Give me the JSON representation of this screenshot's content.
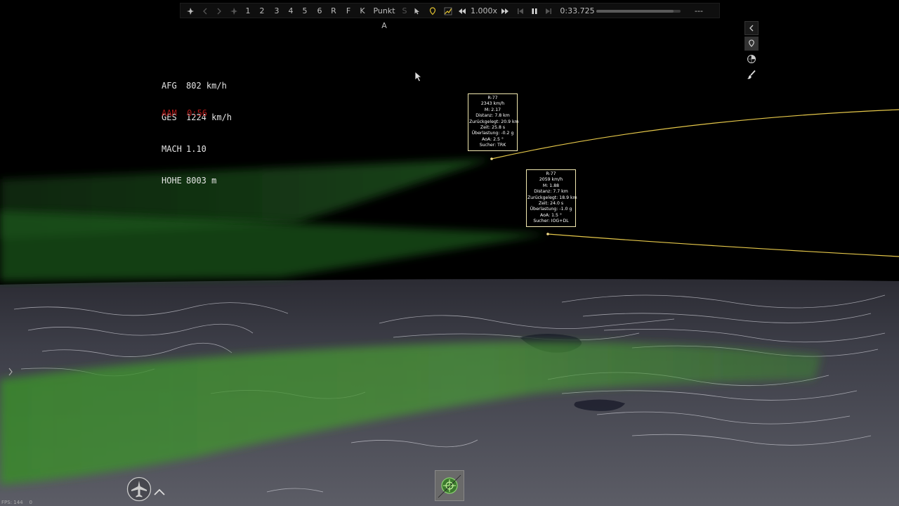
{
  "toolbar": {
    "numbers": [
      "1",
      "2",
      "3",
      "4",
      "5",
      "6"
    ],
    "r": "R",
    "f": "F",
    "k": "K",
    "punkt": "Punkt A",
    "s": "S",
    "speed": "1.000x",
    "time": "0:33.725",
    "extra": "---",
    "progress_pct": 0.92
  },
  "hud": {
    "afg": {
      "label": "AFG",
      "value": "802 km/h"
    },
    "ges": {
      "label": "GES",
      "value": "1224 km/h"
    },
    "mach": {
      "label": "MACH",
      "value": "1.10"
    },
    "hohe": {
      "label": "HOHE",
      "value": "8003 m"
    },
    "aam": "AAM  0:56"
  },
  "missile1": {
    "name": "R-77",
    "speed": "2343 km/h",
    "mach": "M: 2.17",
    "dist": "Distanz: 7.8 km",
    "travelled": "Zurückgelegt: 20.9 km",
    "time": "Zeit: 25.8 s",
    "load": "Überlastung: -0.2 g",
    "aoa": "AoA: 2.5 °",
    "seeker": "Sucher: TRK"
  },
  "missile2": {
    "name": "R-77",
    "speed": "2059 km/h",
    "mach": "M: 1.88",
    "dist": "Distanz: 7.7 km",
    "travelled": "Zurückgelegt: 18.9 km",
    "time": "Zeit: 24.0 s",
    "load": "Überlastung: -1.0 g",
    "aoa": "AoA: 1.5 °",
    "seeker": "Sucher: IOG+DL"
  },
  "footer": {
    "fps": "FPS: 144    0"
  },
  "colors": {
    "trail": "#e6c84a",
    "radar": "#2f7d2a",
    "hud_alert": "#b01818",
    "box_border": "#f2e9b0"
  }
}
